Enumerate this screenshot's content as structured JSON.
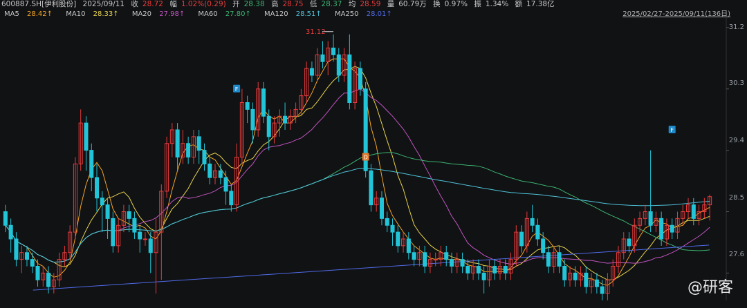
{
  "header": {
    "code": "600887.SH[伊利股份]",
    "date": "2025/09/11",
    "close_label": "收",
    "close": "28.72",
    "change_label": "幅",
    "change": "1.02%(0.29)",
    "open_label": "开",
    "open": "28.38",
    "high_label": "高",
    "high": "28.75",
    "low_label": "低",
    "low": "28.37",
    "avg_label": "均",
    "avg": "28.59",
    "vol_label": "量",
    "vol": "60.79万",
    "turnover_label": "换",
    "turnover": "0.97%",
    "amp_label": "振",
    "amp": "1.34%",
    "amount_label": "额",
    "amount": "17.38亿",
    "range": "2025/02/27-2025/09/11(136日)"
  },
  "ma_legend": [
    {
      "name": "MA5",
      "value": "28.42↑",
      "color": "#f5a623"
    },
    {
      "name": "MA10",
      "value": "28.33↑",
      "color": "#e8d44d"
    },
    {
      "name": "MA20",
      "value": "27.98↑",
      "color": "#c154c1"
    },
    {
      "name": "MA60",
      "value": "27.80↑",
      "color": "#3cb371"
    },
    {
      "name": "MA120",
      "value": "28.51↑",
      "color": "#4fc3d9"
    },
    {
      "name": "MA250",
      "value": "28.01↑",
      "color": "#4f6be8"
    }
  ],
  "watermark": "@研客",
  "chart_data": {
    "type": "candlestick",
    "ylim": [
      27.3,
      31.3
    ],
    "yticks": [
      "31.2",
      "30.3",
      "29.4",
      "28.5",
      "27.6"
    ],
    "annotations": [
      {
        "label": "31.12",
        "text": "high"
      }
    ],
    "markers": [
      "F",
      "D",
      "F"
    ],
    "up_color": "#e83b3b",
    "down_color": "#22c5d8",
    "candles": [
      [
        28.5,
        28.3,
        28.6,
        28.2
      ],
      [
        28.3,
        28.1,
        28.4,
        27.9
      ],
      [
        28.1,
        27.8,
        28.2,
        27.7
      ],
      [
        27.8,
        27.9,
        28.0,
        27.6
      ],
      [
        27.9,
        27.8,
        28.0,
        27.7
      ],
      [
        27.8,
        27.7,
        27.9,
        27.6
      ],
      [
        27.7,
        27.5,
        27.8,
        27.4
      ],
      [
        27.5,
        27.6,
        27.7,
        27.4
      ],
      [
        27.6,
        27.4,
        27.7,
        27.3
      ],
      [
        27.4,
        27.5,
        27.6,
        27.3
      ],
      [
        27.5,
        27.8,
        27.9,
        27.4
      ],
      [
        27.8,
        27.9,
        28.0,
        27.7
      ],
      [
        27.9,
        28.2,
        28.3,
        27.8
      ],
      [
        28.2,
        29.2,
        29.3,
        28.1
      ],
      [
        29.2,
        29.8,
        30.0,
        29.1
      ],
      [
        29.8,
        29.4,
        29.9,
        29.1
      ],
      [
        29.4,
        29.0,
        29.5,
        28.8
      ],
      [
        29.0,
        28.7,
        29.2,
        28.5
      ],
      [
        28.7,
        28.6,
        28.8,
        28.2
      ],
      [
        28.6,
        28.4,
        28.7,
        28.1
      ],
      [
        28.4,
        28.0,
        28.5,
        27.9
      ],
      [
        28.0,
        28.3,
        28.4,
        27.9
      ],
      [
        28.3,
        28.5,
        28.6,
        28.2
      ],
      [
        28.5,
        28.4,
        28.6,
        28.2
      ],
      [
        28.4,
        28.2,
        28.5,
        28.1
      ],
      [
        28.2,
        28.1,
        28.3,
        27.9
      ],
      [
        28.1,
        28.1,
        28.2,
        28.0
      ],
      [
        28.1,
        27.9,
        28.2,
        27.6
      ],
      [
        27.9,
        28.2,
        28.4,
        27.3
      ],
      [
        28.2,
        28.8,
        28.9,
        27.5
      ],
      [
        28.8,
        29.5,
        29.6,
        28.7
      ],
      [
        29.5,
        29.7,
        29.8,
        29.3
      ],
      [
        29.7,
        29.3,
        29.8,
        29.1
      ],
      [
        29.3,
        29.5,
        29.7,
        29.2
      ],
      [
        29.5,
        29.3,
        29.6,
        29.2
      ],
      [
        29.3,
        29.6,
        29.7,
        29.2
      ],
      [
        29.6,
        29.4,
        29.7,
        29.2
      ],
      [
        29.4,
        29.2,
        29.5,
        29.1
      ],
      [
        29.2,
        29.0,
        29.3,
        28.9
      ],
      [
        29.0,
        29.1,
        29.2,
        28.9
      ],
      [
        29.1,
        29.0,
        29.2,
        28.9
      ],
      [
        29.0,
        28.8,
        29.1,
        28.6
      ],
      [
        28.8,
        28.6,
        28.9,
        28.5
      ],
      [
        28.6,
        29.3,
        29.5,
        28.5
      ],
      [
        29.3,
        30.1,
        30.3,
        29.2
      ],
      [
        30.1,
        30.0,
        30.2,
        29.8
      ],
      [
        30.0,
        29.7,
        30.1,
        29.5
      ],
      [
        29.7,
        30.3,
        30.4,
        29.6
      ],
      [
        30.3,
        29.9,
        30.4,
        29.8
      ],
      [
        29.9,
        29.6,
        30.0,
        29.4
      ],
      [
        29.6,
        29.8,
        29.9,
        29.5
      ],
      [
        29.8,
        29.9,
        30.0,
        29.6
      ],
      [
        29.9,
        29.8,
        30.1,
        29.7
      ],
      [
        29.8,
        29.9,
        30.0,
        29.7
      ],
      [
        29.9,
        30.0,
        30.1,
        29.8
      ],
      [
        30.0,
        30.2,
        30.3,
        29.9
      ],
      [
        30.2,
        30.6,
        30.7,
        30.1
      ],
      [
        30.6,
        30.5,
        30.7,
        30.4
      ],
      [
        30.5,
        30.8,
        30.9,
        30.4
      ],
      [
        30.8,
        30.7,
        31.0,
        30.6
      ],
      [
        30.7,
        30.9,
        31.0,
        30.5
      ],
      [
        30.9,
        30.8,
        31.1,
        30.7
      ],
      [
        30.8,
        30.5,
        30.9,
        30.4
      ],
      [
        30.5,
        30.8,
        30.9,
        30.4
      ],
      [
        30.8,
        30.1,
        31.1,
        30.0
      ],
      [
        30.1,
        30.6,
        30.7,
        30.0
      ],
      [
        30.6,
        30.3,
        30.7,
        30.2
      ],
      [
        30.3,
        29.1,
        30.4,
        29.0
      ],
      [
        29.1,
        28.6,
        29.2,
        28.5
      ],
      [
        28.6,
        28.7,
        28.8,
        28.5
      ],
      [
        28.7,
        28.4,
        28.8,
        28.3
      ],
      [
        28.4,
        28.3,
        28.5,
        28.2
      ],
      [
        28.3,
        28.2,
        28.4,
        28.0
      ],
      [
        28.2,
        28.0,
        28.3,
        27.9
      ],
      [
        28.0,
        28.1,
        28.2,
        27.9
      ],
      [
        28.1,
        27.9,
        28.2,
        27.8
      ],
      [
        27.9,
        27.8,
        28.0,
        27.7
      ],
      [
        27.8,
        27.9,
        28.0,
        27.7
      ],
      [
        27.9,
        27.7,
        28.0,
        27.6
      ],
      [
        27.7,
        27.8,
        27.9,
        27.6
      ],
      [
        27.8,
        27.8,
        27.9,
        27.7
      ],
      [
        27.8,
        27.9,
        28.0,
        27.7
      ],
      [
        27.9,
        27.8,
        28.0,
        27.7
      ],
      [
        27.8,
        27.7,
        27.9,
        27.6
      ],
      [
        27.7,
        27.8,
        27.9,
        27.6
      ],
      [
        27.8,
        27.7,
        27.9,
        27.6
      ],
      [
        27.7,
        27.6,
        27.8,
        27.5
      ],
      [
        27.6,
        27.7,
        27.8,
        27.5
      ],
      [
        27.7,
        27.6,
        27.8,
        27.5
      ],
      [
        27.6,
        27.5,
        27.7,
        27.3
      ],
      [
        27.5,
        27.7,
        27.8,
        27.4
      ],
      [
        27.7,
        27.6,
        27.8,
        27.5
      ],
      [
        27.6,
        27.7,
        27.8,
        27.5
      ],
      [
        27.7,
        27.6,
        27.8,
        27.5
      ],
      [
        27.6,
        27.8,
        27.9,
        27.5
      ],
      [
        27.8,
        28.2,
        28.3,
        27.7
      ],
      [
        28.2,
        28.0,
        28.3,
        27.9
      ],
      [
        28.0,
        28.4,
        28.5,
        27.9
      ],
      [
        28.4,
        28.3,
        28.6,
        28.2
      ],
      [
        28.3,
        28.1,
        28.4,
        28.0
      ],
      [
        28.1,
        27.9,
        28.2,
        27.8
      ],
      [
        27.9,
        27.7,
        28.0,
        27.6
      ],
      [
        27.7,
        27.9,
        28.0,
        27.6
      ],
      [
        27.9,
        27.7,
        28.0,
        27.6
      ],
      [
        27.7,
        27.5,
        27.8,
        27.4
      ],
      [
        27.5,
        27.6,
        27.7,
        27.4
      ],
      [
        27.6,
        27.5,
        27.7,
        27.4
      ],
      [
        27.5,
        27.6,
        27.7,
        27.4
      ],
      [
        27.6,
        27.4,
        27.7,
        27.3
      ],
      [
        27.4,
        27.5,
        27.6,
        27.3
      ],
      [
        27.5,
        27.4,
        27.6,
        27.3
      ],
      [
        27.4,
        27.3,
        27.5,
        27.2
      ],
      [
        27.3,
        27.5,
        27.6,
        27.2
      ],
      [
        27.5,
        27.7,
        27.8,
        27.4
      ],
      [
        27.7,
        27.9,
        28.0,
        27.6
      ],
      [
        27.9,
        28.1,
        28.2,
        27.8
      ],
      [
        28.1,
        28.0,
        28.2,
        27.9
      ],
      [
        28.0,
        28.3,
        28.4,
        27.9
      ],
      [
        28.3,
        28.4,
        28.5,
        28.2
      ],
      [
        28.4,
        28.5,
        28.6,
        28.3
      ],
      [
        28.5,
        28.3,
        29.4,
        28.2
      ],
      [
        28.3,
        28.4,
        28.5,
        28.2
      ],
      [
        28.4,
        28.1,
        28.5,
        28.0
      ],
      [
        28.1,
        28.3,
        28.4,
        28.0
      ],
      [
        28.3,
        28.2,
        28.4,
        28.1
      ],
      [
        28.2,
        28.4,
        28.5,
        28.1
      ],
      [
        28.4,
        28.5,
        28.6,
        28.3
      ],
      [
        28.5,
        28.6,
        28.7,
        28.4
      ],
      [
        28.6,
        28.4,
        28.7,
        28.3
      ],
      [
        28.4,
        28.5,
        28.6,
        28.3
      ],
      [
        28.5,
        28.6,
        28.7,
        28.4
      ],
      [
        28.6,
        28.72,
        28.75,
        28.37
      ]
    ]
  }
}
